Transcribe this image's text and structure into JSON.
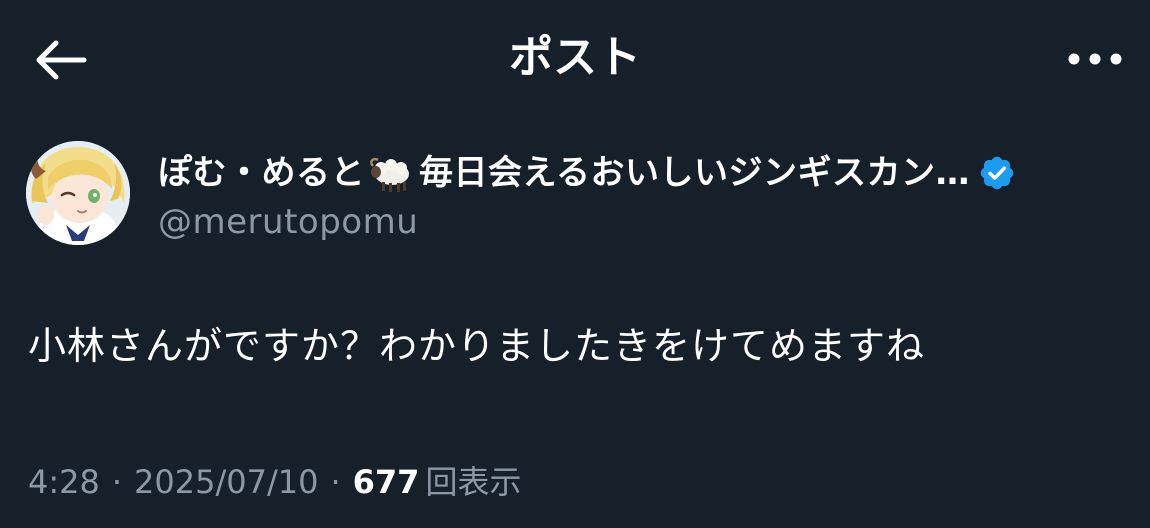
{
  "header": {
    "title": "ポスト",
    "back_icon": "arrow-left-icon",
    "more_icon": "more-horizontal-icon"
  },
  "author": {
    "display_name_part1": "ぽむ・めると",
    "emoji": "sheep-emoji",
    "display_name_part2": "毎日会えるおいしいジンギスカン…",
    "verified_icon": "verified-badge-icon",
    "verified_color": "#1d9bf0",
    "handle": "@merutopomu"
  },
  "post": {
    "text": "小林さんがですか？わかりましたきをけてめますね"
  },
  "meta": {
    "time": "4:28",
    "separator": "·",
    "date": "2025/07/10",
    "views_count": "677",
    "views_label": "回表示"
  },
  "colors": {
    "background": "#15202b",
    "secondary_text": "#8b98a5",
    "primary_text": "#ffffff"
  }
}
